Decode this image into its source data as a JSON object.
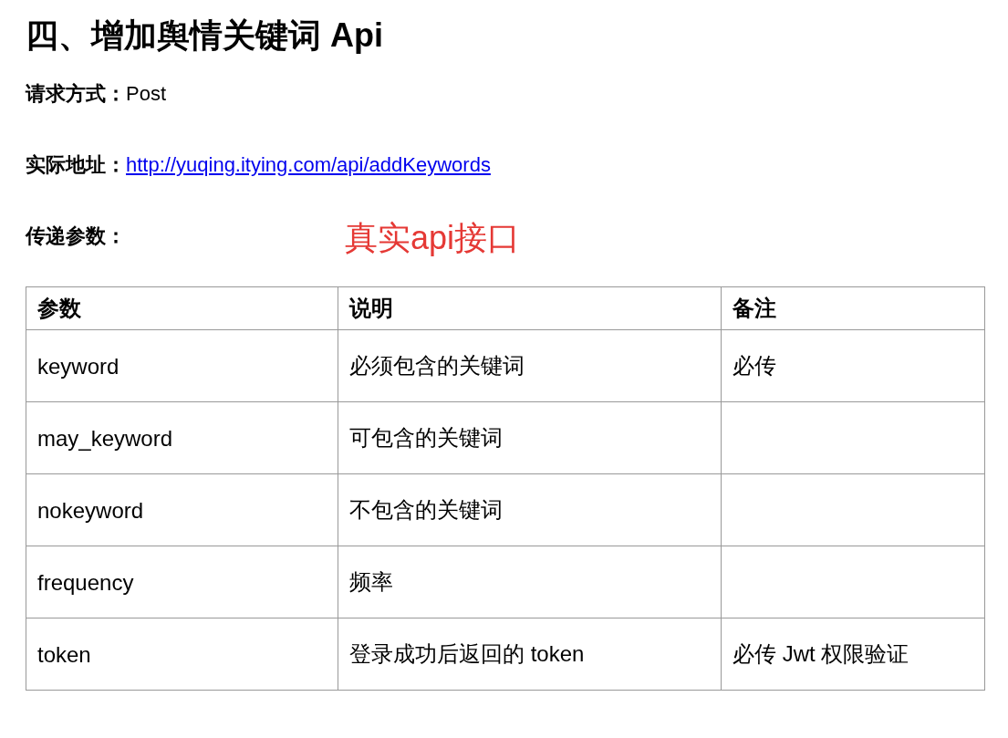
{
  "title": "四、增加舆情关键词 Api",
  "fields": [
    {
      "label": "请求方式：",
      "value": "Post",
      "kind": "text"
    },
    {
      "label": "实际地址：",
      "value": "http://yuqing.itying.com/api/addKeywords",
      "kind": "link"
    },
    {
      "label": "传递参数：",
      "annotation": "真实api接口"
    }
  ],
  "table": {
    "columns": [
      "参数",
      "说明",
      "备注"
    ],
    "rows": [
      [
        "keyword",
        "必须包含的关键词",
        "必传"
      ],
      [
        "may_keyword",
        "可包含的关键词",
        ""
      ],
      [
        "nokeyword",
        "不包含的关键词",
        ""
      ],
      [
        "frequency",
        "频率",
        ""
      ],
      [
        "token",
        "登录成功后返回的 token",
        "必传 Jwt 权限验证"
      ]
    ]
  }
}
